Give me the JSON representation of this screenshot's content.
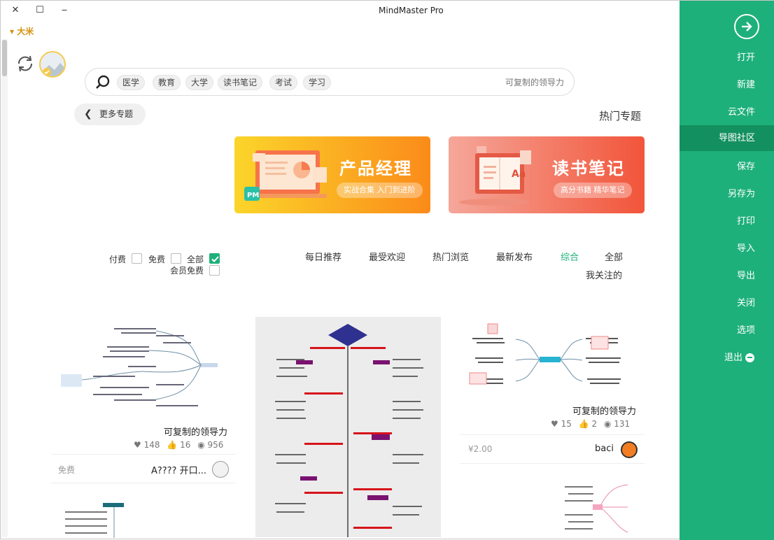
{
  "window": {
    "title": "MindMaster Pro",
    "user": "大米",
    "controls": {
      "close": "✕",
      "maximize": "☐",
      "minimize": "‒"
    }
  },
  "search": {
    "placeholder": "可复制的领导力",
    "tags": [
      "学习",
      "考试",
      "读书笔记",
      "大学",
      "教育",
      "医学"
    ]
  },
  "hot": {
    "title": "热门专题",
    "more_label": "更多专题"
  },
  "banners": [
    {
      "title": "读书笔记",
      "subtitle": "高分书籍 精华笔记",
      "icon": "book-illustration-icon"
    },
    {
      "title": "产品经理",
      "subtitle": "实战合集 入门到进阶",
      "icon": "laptop-illustration-icon"
    }
  ],
  "filters": {
    "tabs": [
      "全部",
      "综合",
      "最新发布",
      "热门浏览",
      "最受欢迎",
      "每日推荐",
      "我关注的"
    ],
    "active_tab": "综合",
    "price": {
      "all": "全部",
      "free": "免费",
      "paid": "付费",
      "member_free": "会员免费"
    }
  },
  "cards": [
    {
      "title": "可复制的领导力",
      "views": "131",
      "likes": "2",
      "favorites": "15",
      "author": "baci",
      "price": "¥2.00"
    },
    {
      "title": "可复制的领导力",
      "views": "956",
      "likes": "16",
      "favorites": "148",
      "author": "A???? 开口...",
      "price": "免费"
    }
  ],
  "sidebar": {
    "items": [
      "打开",
      "新建",
      "云文件",
      "导图社区",
      "保存",
      "另存为",
      "打印",
      "导入",
      "导出",
      "关闭",
      "选项",
      "退出"
    ],
    "active": "导图社区"
  },
  "colors": {
    "accent": "#1eb07a",
    "sidebar": "#1eb07a",
    "sidebar_active": "#13905f"
  }
}
